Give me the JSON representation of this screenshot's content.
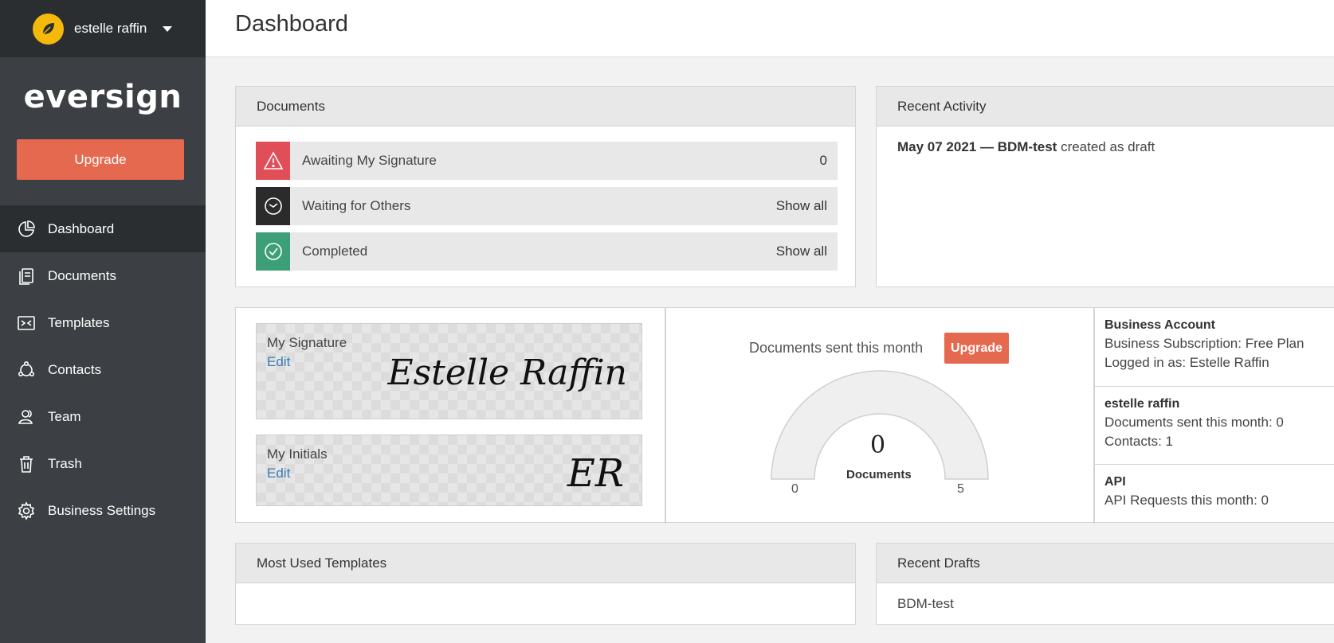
{
  "user": {
    "name": "estelle raffin"
  },
  "brand": {
    "name": "eversign"
  },
  "sidebar": {
    "upgrade_label": "Upgrade",
    "items": [
      {
        "label": "Dashboard",
        "icon": "pie-chart-icon"
      },
      {
        "label": "Documents",
        "icon": "documents-icon"
      },
      {
        "label": "Templates",
        "icon": "templates-icon"
      },
      {
        "label": "Contacts",
        "icon": "contacts-icon"
      },
      {
        "label": "Team",
        "icon": "team-icon"
      },
      {
        "label": "Trash",
        "icon": "trash-icon"
      },
      {
        "label": "Business Settings",
        "icon": "gear-icon"
      }
    ]
  },
  "header": {
    "title": "Dashboard"
  },
  "documents": {
    "title": "Documents",
    "rows": [
      {
        "label": "Awaiting My Signature",
        "right": "0",
        "icon": "warning-icon",
        "color": "#e04e58"
      },
      {
        "label": "Waiting for Others",
        "right": "Show all",
        "icon": "clock-icon",
        "color": "#2b2b2b"
      },
      {
        "label": "Completed",
        "right": "Show all",
        "icon": "check-icon",
        "color": "#3d9f78"
      }
    ]
  },
  "activity": {
    "title": "Recent Activity",
    "date": "May 07 2021",
    "separator": "—",
    "doc": "BDM-test",
    "action": "created as draft"
  },
  "signature": {
    "label": "My Signature",
    "edit": "Edit",
    "script": "Estelle Raffin"
  },
  "initials": {
    "label": "My Initials",
    "edit": "Edit",
    "script": "ER"
  },
  "gauge": {
    "title": "Documents sent this month",
    "upgrade_label": "Upgrade",
    "value": "0",
    "unit": "Documents",
    "min": "0",
    "max": "5",
    "fill": 0
  },
  "account": {
    "business_title": "Business Account",
    "subscription": "Business Subscription: Free Plan",
    "logged_in": "Logged in as: Estelle Raffin",
    "user_title": "estelle raffin",
    "docs_sent": "Documents sent this month: 0",
    "contacts": "Contacts: 1",
    "api_title": "API",
    "api_requests": "API Requests this month: 0"
  },
  "templates": {
    "title": "Most Used Templates"
  },
  "drafts": {
    "title": "Recent Drafts",
    "items": [
      "BDM-test"
    ]
  },
  "colors": {
    "accent": "#e4694f",
    "sidebar": "#3c3f43",
    "sidebar_dark": "#2b2e31",
    "link": "#3a7bb6"
  }
}
